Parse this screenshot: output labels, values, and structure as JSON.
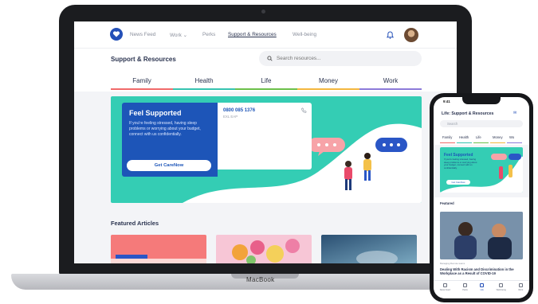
{
  "colors": {
    "brand_blue": "#1d55b8",
    "teal": "#34cdb4",
    "family": "#f06a6a",
    "health": "#36c3b0",
    "life": "#6cc04a",
    "money": "#f4b73e",
    "work": "#8c7ad9"
  },
  "laptop": {
    "brand": "MacBook",
    "nav": {
      "items": [
        "News Feed",
        "Work ⌄",
        "Perks",
        "Support & Resources",
        "Well-being"
      ],
      "active_index": 3
    },
    "page_title": "Support & Resources",
    "search_placeholder": "Search resources...",
    "tabs": [
      "Family",
      "Health",
      "Life",
      "Money",
      "Work"
    ],
    "hero": {
      "title": "Feel Supported",
      "text": "If you're feeling stressed, having sleep problems or worrying about your budget, connect with us confidentially.",
      "cta": "Get CareNow",
      "phone": "0800 085 1376",
      "phone_sub": "EXL EAP"
    },
    "featured_title": "Featured Articles"
  },
  "phone": {
    "time": "9:41",
    "title": "Life: Support & Resources",
    "search_placeholder": "Search",
    "tabs": [
      "Family",
      "Health",
      "Life",
      "Money",
      "Wo"
    ],
    "hero": {
      "title": "Feel Supported",
      "text": "If you're feeling stressed, having sleep problems or worrying about your budget, connect with us confidentially.",
      "cta": "Get CareNow"
    },
    "featured_title": "Featured",
    "article_kicker": "Managing Remote teams",
    "article_title": "Dealing With Racism and Discrimination in the Workplace as a Result of COVID-19",
    "bottom_nav": [
      "News Feed",
      "Perks",
      "Life",
      "Well-being",
      "Work"
    ],
    "bottom_active": 2
  }
}
